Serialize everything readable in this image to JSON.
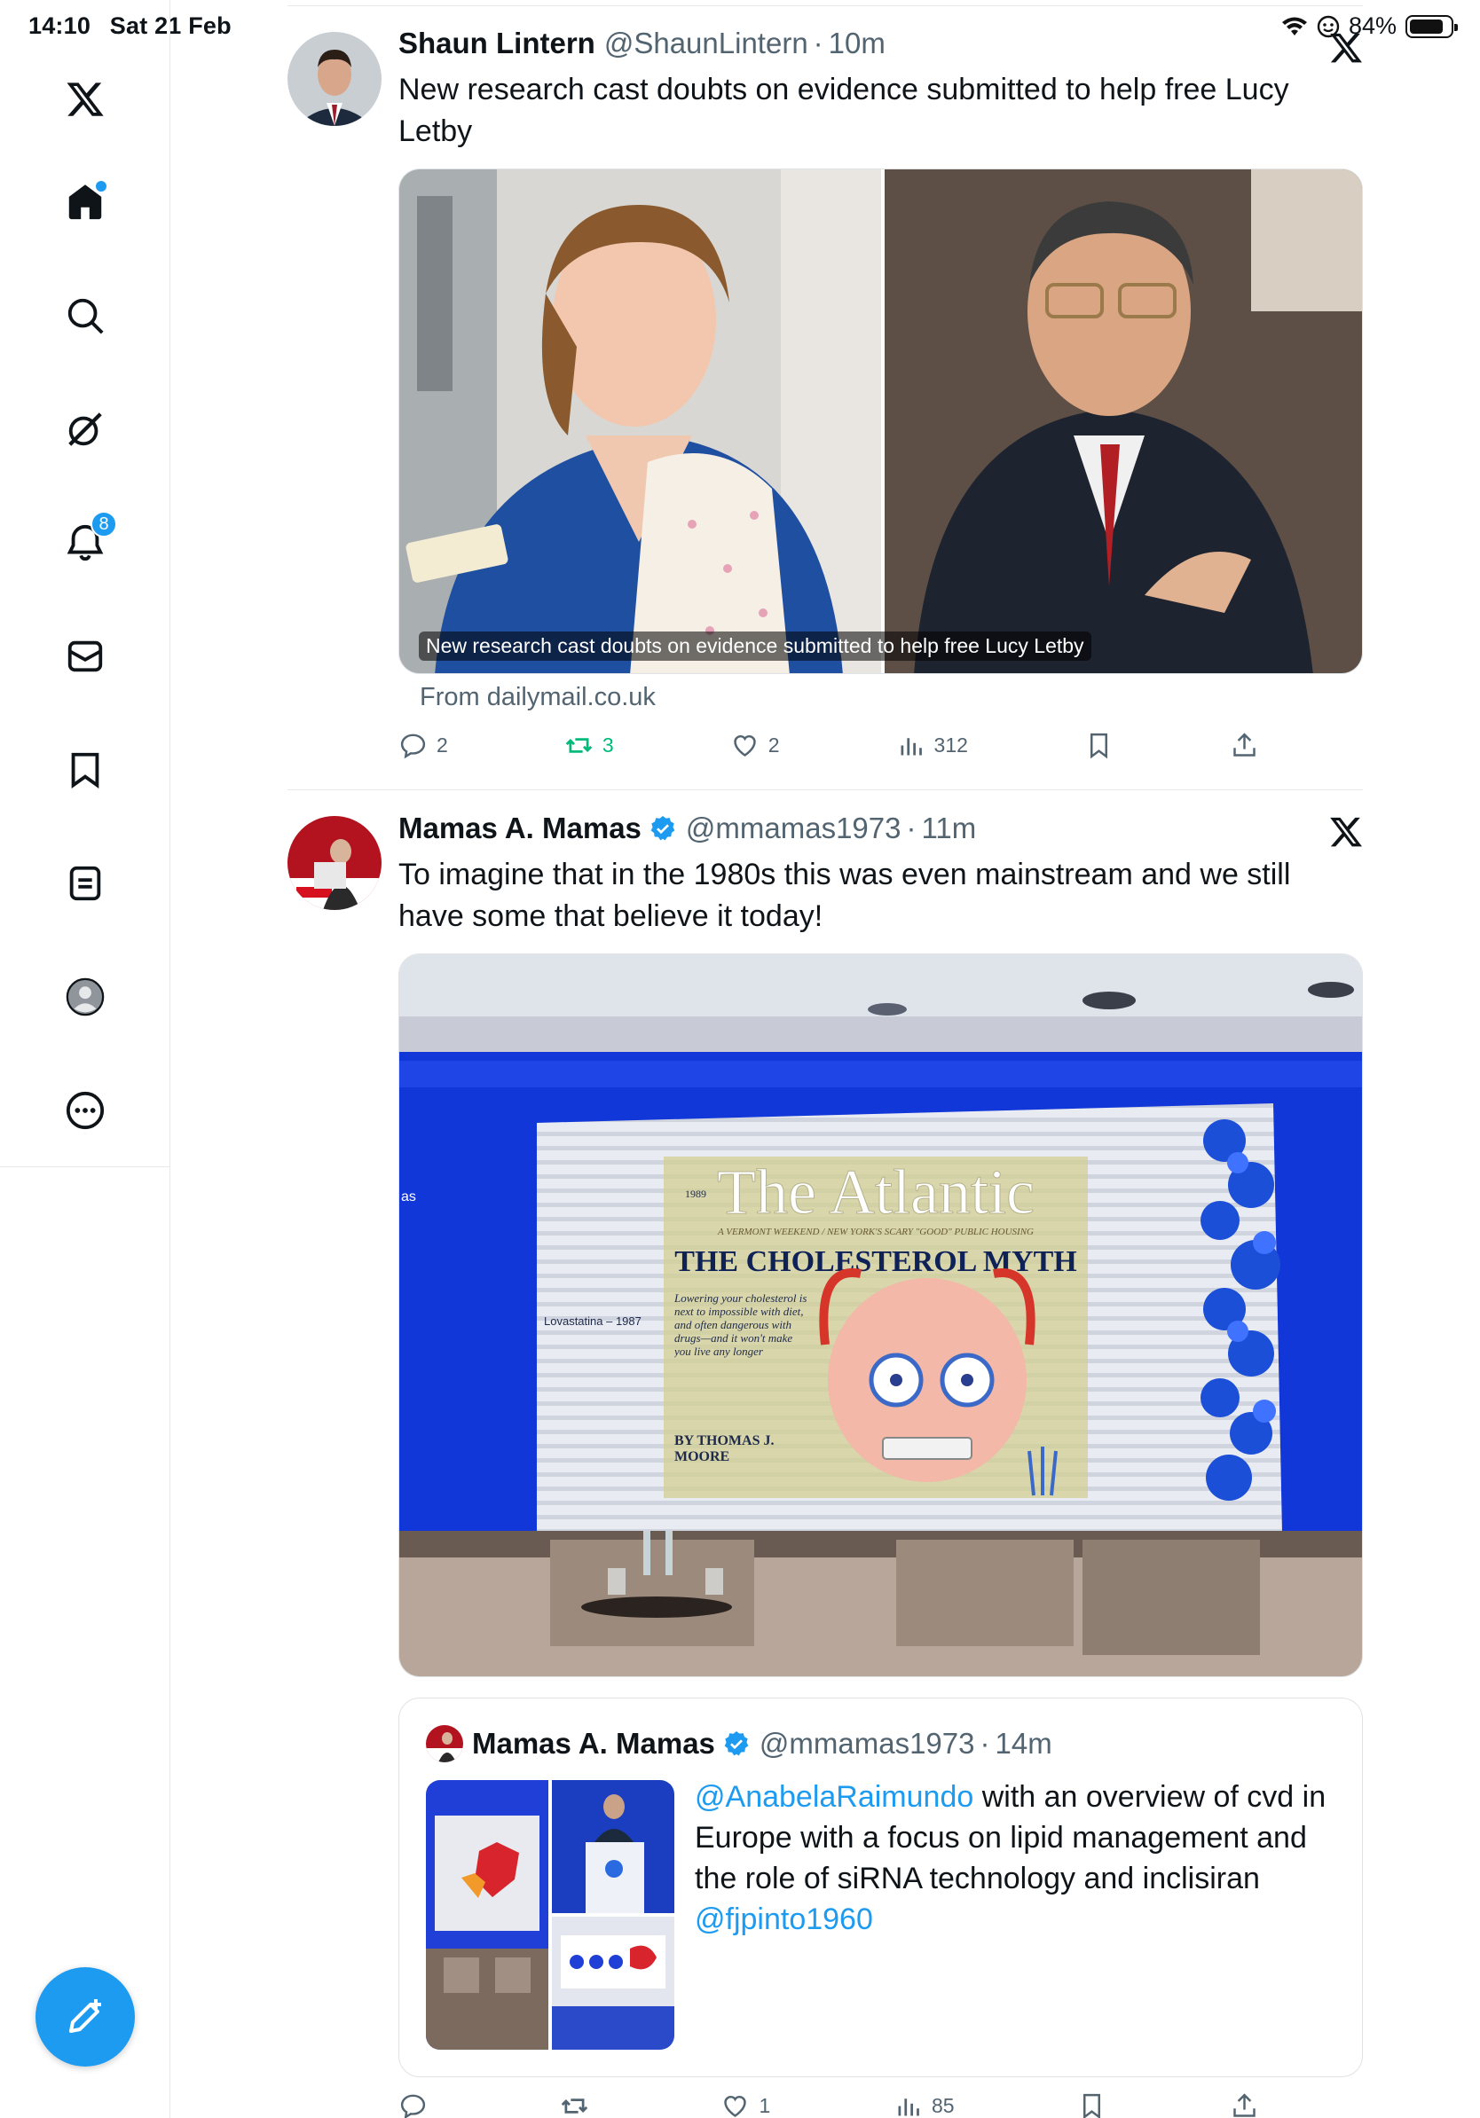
{
  "status_bar": {
    "time": "14:10",
    "date": "Sat 21 Feb",
    "battery": "84%",
    "battery_level": 0.84
  },
  "sidebar": {
    "items": [
      {
        "name": "x-logo",
        "icon": "x-logo-icon"
      },
      {
        "name": "home",
        "icon": "home-icon",
        "active": true,
        "has_dot": true
      },
      {
        "name": "search",
        "icon": "search-icon"
      },
      {
        "name": "grok",
        "icon": "grok-icon"
      },
      {
        "name": "notifications",
        "icon": "bell-icon",
        "badge": "8"
      },
      {
        "name": "messages",
        "icon": "mail-icon"
      },
      {
        "name": "bookmarks",
        "icon": "bookmark-icon"
      },
      {
        "name": "lists",
        "icon": "lists-icon"
      },
      {
        "name": "profile",
        "icon": "profile-avatar-icon"
      },
      {
        "name": "more",
        "icon": "more-circle-icon"
      }
    ],
    "compose_icon": "compose-plus-icon"
  },
  "colors": {
    "accent": "#1d9bf0",
    "text": "#0f1419",
    "secondary": "#536471",
    "retweet_active": "#00ba7c"
  },
  "tweets": [
    {
      "name": "Shaun Lintern",
      "handle": "@ShaunLintern",
      "dot": "·",
      "time": "10m",
      "text": "New research cast doubts on evidence submitted to help free Lucy Letby",
      "card_caption": "New research cast doubts on evidence submitted to help free Lucy Letby",
      "from": "From dailymail.co.uk",
      "replies": "2",
      "retweets": "3",
      "likes": "2",
      "views": "312"
    },
    {
      "name": "Mamas A. Mamas",
      "handle": "@mmamas1973",
      "dot": "·",
      "time": "11m",
      "text": "To imagine that in the 1980s this was even mainstream and we still have some that believe it today!",
      "image": {
        "magazine_title": "The Atlantic",
        "magazine_year": "1989",
        "magazine_subtitle": "A VERMONT WEEKEND / NEW YORK'S SCARY \"GOOD\" PUBLIC HOUSING",
        "headline": "THE CHOLESTEROL MYTH",
        "blurb": "Lowering your cholesterol is next to impossible with diet, and often dangerous with drugs—and it won't make you live any longer",
        "byline": "BY THOMAS J. MOORE",
        "side_label": "Lovastatina – 1987",
        "left_fragment": "as"
      },
      "quote": {
        "name": "Mamas A. Mamas",
        "handle": "@mmamas1973",
        "dot": "·",
        "time": "14m",
        "mention1": "@AnabelaRaimundo",
        "text": " with an overview of cvd in Europe with a focus on lipid management and the role of siRNA technology and inclisiran ",
        "mention2": "@fjpinto1960"
      },
      "replies": "",
      "retweets": "",
      "likes": "1",
      "views": "85"
    }
  ]
}
